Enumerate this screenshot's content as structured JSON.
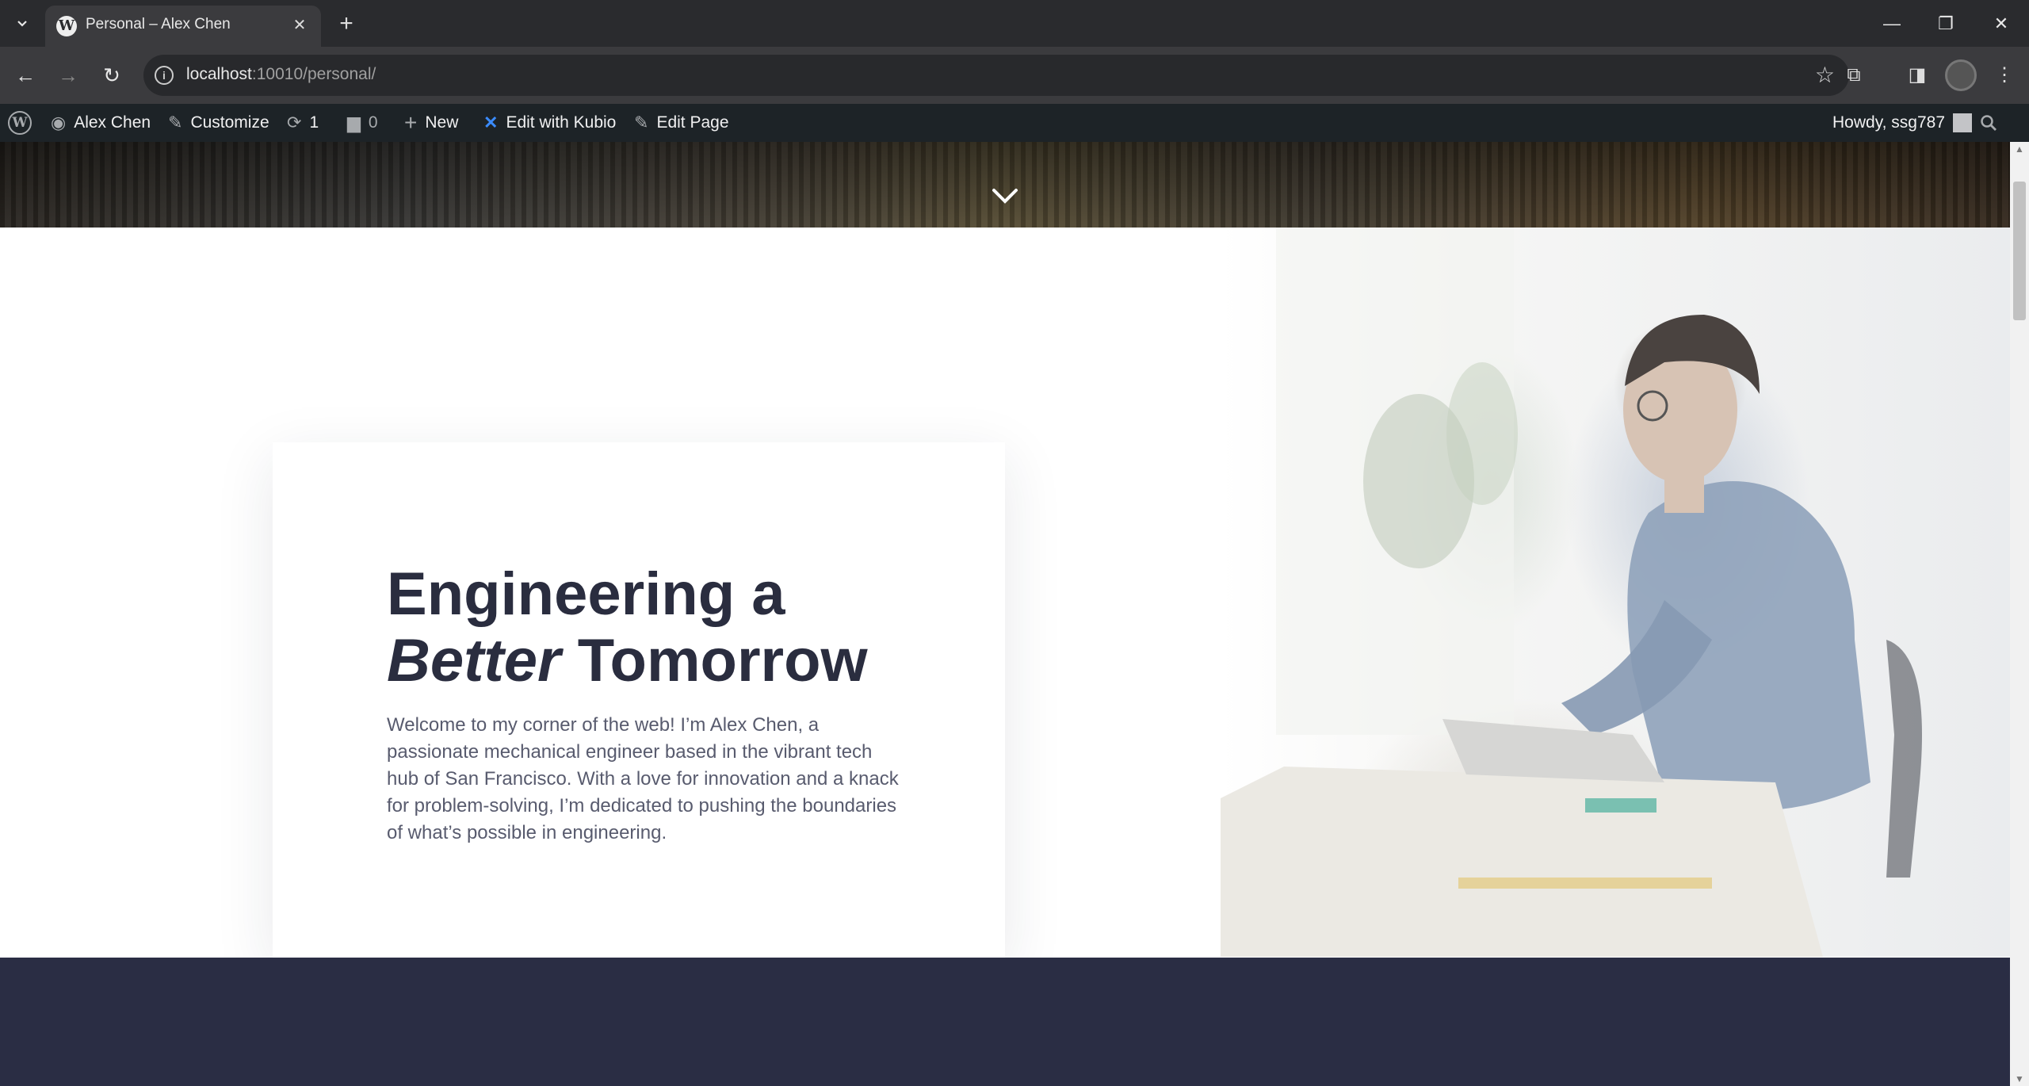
{
  "browser": {
    "tab_title": "Personal – Alex Chen",
    "url_host": "localhost",
    "url_path": ":10010/personal/"
  },
  "adminbar": {
    "site_name": "Alex Chen",
    "customize": "Customize",
    "updates_count": "1",
    "comments_count": "0",
    "new": "New",
    "edit_kubio": "Edit with Kubio",
    "edit_page": "Edit Page",
    "howdy": "Howdy, ssg787"
  },
  "hero": {
    "heading_line1": "Engineering a",
    "heading_italic": "Better",
    "heading_line2_rest": " Tomorrow",
    "intro": "Welcome to my corner of the web! I’m Alex Chen, a passionate mechanical engineer based in the vibrant tech hub of San Francisco. With a love for innovation and a knack for problem-solving, I’m dedicated to pushing the boundaries of what’s possible in engineering."
  },
  "colors": {
    "heading": "#2a2d3f",
    "body_text": "#585b6e",
    "dark_section": "#2a2d44",
    "adminbar": "#1d2327"
  }
}
